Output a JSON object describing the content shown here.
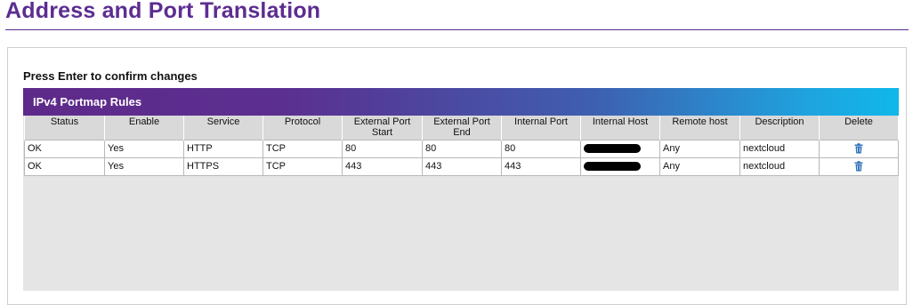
{
  "page": {
    "title": "Address and Port Translation",
    "hint": "Press Enter to confirm changes"
  },
  "table": {
    "title": "IPv4 Portmap Rules",
    "columns": [
      "Status",
      "Enable",
      "Service",
      "Protocol",
      "External Port Start",
      "External Port End",
      "Internal Port",
      "Internal Host",
      "Remote host",
      "Description",
      "Delete"
    ],
    "rows": [
      {
        "status": "OK",
        "enable": "Yes",
        "service": "HTTP",
        "protocol": "TCP",
        "ext_start": "80",
        "ext_end": "80",
        "int_port": "80",
        "int_host": "[redacted]",
        "remote_host": "Any",
        "description": "nextcloud",
        "delete_icon": "trash-icon"
      },
      {
        "status": "OK",
        "enable": "Yes",
        "service": "HTTPS",
        "protocol": "TCP",
        "ext_start": "443",
        "ext_end": "443",
        "int_port": "443",
        "int_host": "[redacted]",
        "remote_host": "Any",
        "description": "nextcloud",
        "delete_icon": "trash-icon"
      }
    ]
  },
  "colors": {
    "brand_purple": "#5c2d91",
    "header_gradient_start": "#5e2a8a",
    "header_gradient_end": "#10b8ea",
    "trash_blue": "#2a6fb8"
  }
}
